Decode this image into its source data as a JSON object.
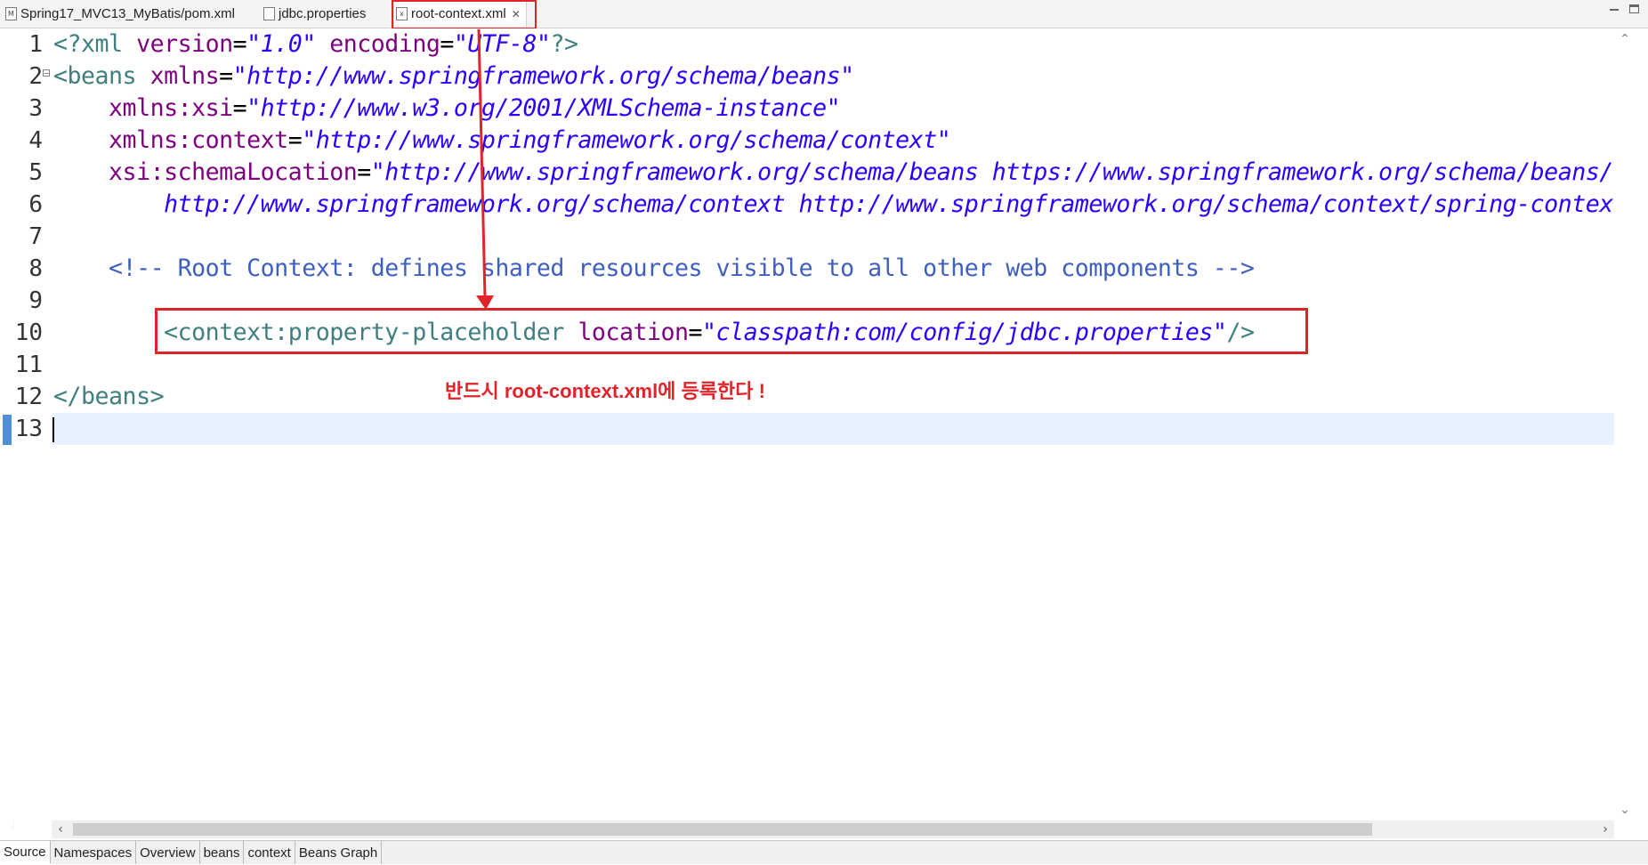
{
  "tabs": [
    {
      "label": "Spring17_MVC13_MyBatis/pom.xml",
      "icon": "xml-file-icon",
      "active": false
    },
    {
      "label": "jdbc.properties",
      "icon": "properties-file-icon",
      "active": false
    },
    {
      "label": "root-context.xml",
      "icon": "xml-file-icon",
      "active": true
    }
  ],
  "gutter": {
    "line_numbers": [
      "1",
      "2",
      "3",
      "4",
      "5",
      "6",
      "7",
      "8",
      "9",
      "10",
      "11",
      "12",
      "13"
    ]
  },
  "code": {
    "line1": {
      "pi_open": "<?xml ",
      "attr1": "version",
      "eq1": "=",
      "val1": "\"1.0\"",
      "sp": " ",
      "attr2": "encoding",
      "eq2": "=",
      "val2": "\"UTF-8\"",
      "pi_close": "?>"
    },
    "line2": {
      "tag": "<beans ",
      "attr": "xmlns",
      "eq": "=",
      "val": "\"http://www.springframework.org/schema/beans\""
    },
    "line3": {
      "indent": "    ",
      "attr": "xmlns:xsi",
      "eq": "=",
      "val": "\"http://www.w3.org/2001/XMLSchema-instance\""
    },
    "line4": {
      "indent": "    ",
      "attr": "xmlns:context",
      "eq": "=",
      "val": "\"http://www.springframework.org/schema/context\""
    },
    "line5": {
      "indent": "    ",
      "attr": "xsi:schemaLocation",
      "eq": "=",
      "val": "\"http://www.springframework.org/schema/beans https://www.springframework.org/schema/beans/spring-beans.xsd"
    },
    "line6": {
      "indent": "        ",
      "val": "http://www.springframework.org/schema/context http://www.springframework.org/schema/context/spring-context.xsd\">"
    },
    "line8": {
      "indent": "    ",
      "comment": "<!-- Root Context: defines shared resources visible to all other web components -->"
    },
    "line10": {
      "indent": "        ",
      "tag": "<context:property-placeholder ",
      "attr": "location",
      "eq": "=",
      "val": "\"classpath:com/config/jdbc.properties\"",
      "close": "/>"
    },
    "line12": {
      "tag": "</beans>"
    }
  },
  "annotation": {
    "note": "반드시 root-context.xml에 등록한다 !",
    "color": "#e0242a"
  },
  "editor_tabs": [
    "Source",
    "Namespaces",
    "Overview",
    "beans",
    "context",
    "Beans Graph"
  ],
  "active_editor_tab": "Source"
}
